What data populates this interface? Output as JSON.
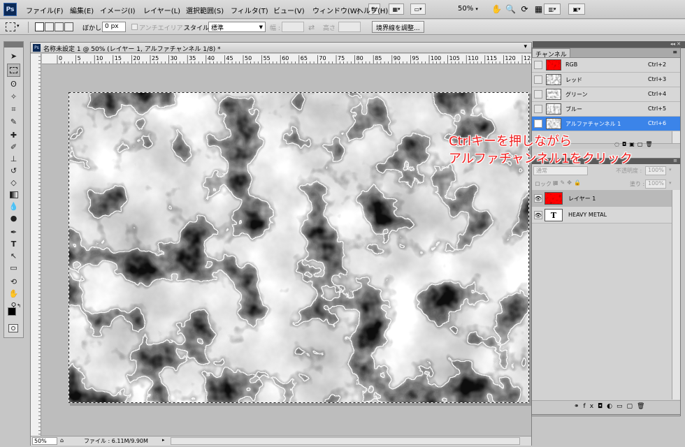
{
  "app": {
    "logo": "Ps"
  },
  "menubar": {
    "items": [
      "ファイル(F)",
      "編集(E)",
      "イメージ(I)",
      "レイヤー(L)",
      "選択範囲(S)",
      "フィルタ(T)",
      "ビュー(V)",
      "ウィンドウ(W)",
      "ヘルプ(H)"
    ],
    "bridge_label": "Br",
    "zoom": "50%"
  },
  "options": {
    "feather_label": "ぼかし :",
    "feather_value": "0 px",
    "antialias_label": "アンチエイリアス",
    "style_label": "スタイル :",
    "style_value": "標準",
    "width_label": "幅 :",
    "height_label": "高さ :",
    "refine_button": "境界線を調整..."
  },
  "document": {
    "title": "名称未設定 1 @ 50% (レイヤー 1, アルファチャンネル 1/8) *",
    "zoom": "50%",
    "file_info": "ファイル : 6.11M/9.90M",
    "ruler_labels": [
      "0",
      "5",
      "10",
      "15",
      "20",
      "25",
      "30",
      "35",
      "40",
      "45",
      "50",
      "55",
      "60",
      "65",
      "70",
      "75",
      "80",
      "85",
      "90",
      "95",
      "100",
      "105",
      "110",
      "115",
      "120",
      "125"
    ]
  },
  "channels": {
    "tab": "チャンネル",
    "items": [
      {
        "name": "RGB",
        "shortcut": "Ctrl+2",
        "thumb": "red",
        "visible": false,
        "selected": false
      },
      {
        "name": "レッド",
        "shortcut": "Ctrl+3",
        "thumb": "gray",
        "visible": false,
        "selected": false
      },
      {
        "name": "グリーン",
        "shortcut": "Ctrl+4",
        "thumb": "gray",
        "visible": false,
        "selected": false
      },
      {
        "name": "ブルー",
        "shortcut": "Ctrl+5",
        "thumb": "gray",
        "visible": false,
        "selected": false
      },
      {
        "name": "アルファチャンネル 1",
        "shortcut": "Ctrl+6",
        "thumb": "gray",
        "visible": true,
        "selected": true
      }
    ]
  },
  "layers": {
    "blend_mode": "通常",
    "opacity_label": "不透明度 :",
    "opacity": "100%",
    "lock_label": "ロック :",
    "fill_label": "塗り :",
    "fill": "100%",
    "items": [
      {
        "name": "レイヤー 1",
        "type": "raster",
        "selected": true
      },
      {
        "name": "HEAVY METAL",
        "type": "text",
        "selected": false
      }
    ],
    "text_layer_glyph": "T"
  },
  "annotation": {
    "line1": "Ctrlキーを押しながら",
    "line2": "アルファチャンネル1をクリック",
    "color": "#ef1c1c"
  },
  "colors": {
    "selected_row": "#3b84e9",
    "annotation": "#ef1c1c"
  }
}
